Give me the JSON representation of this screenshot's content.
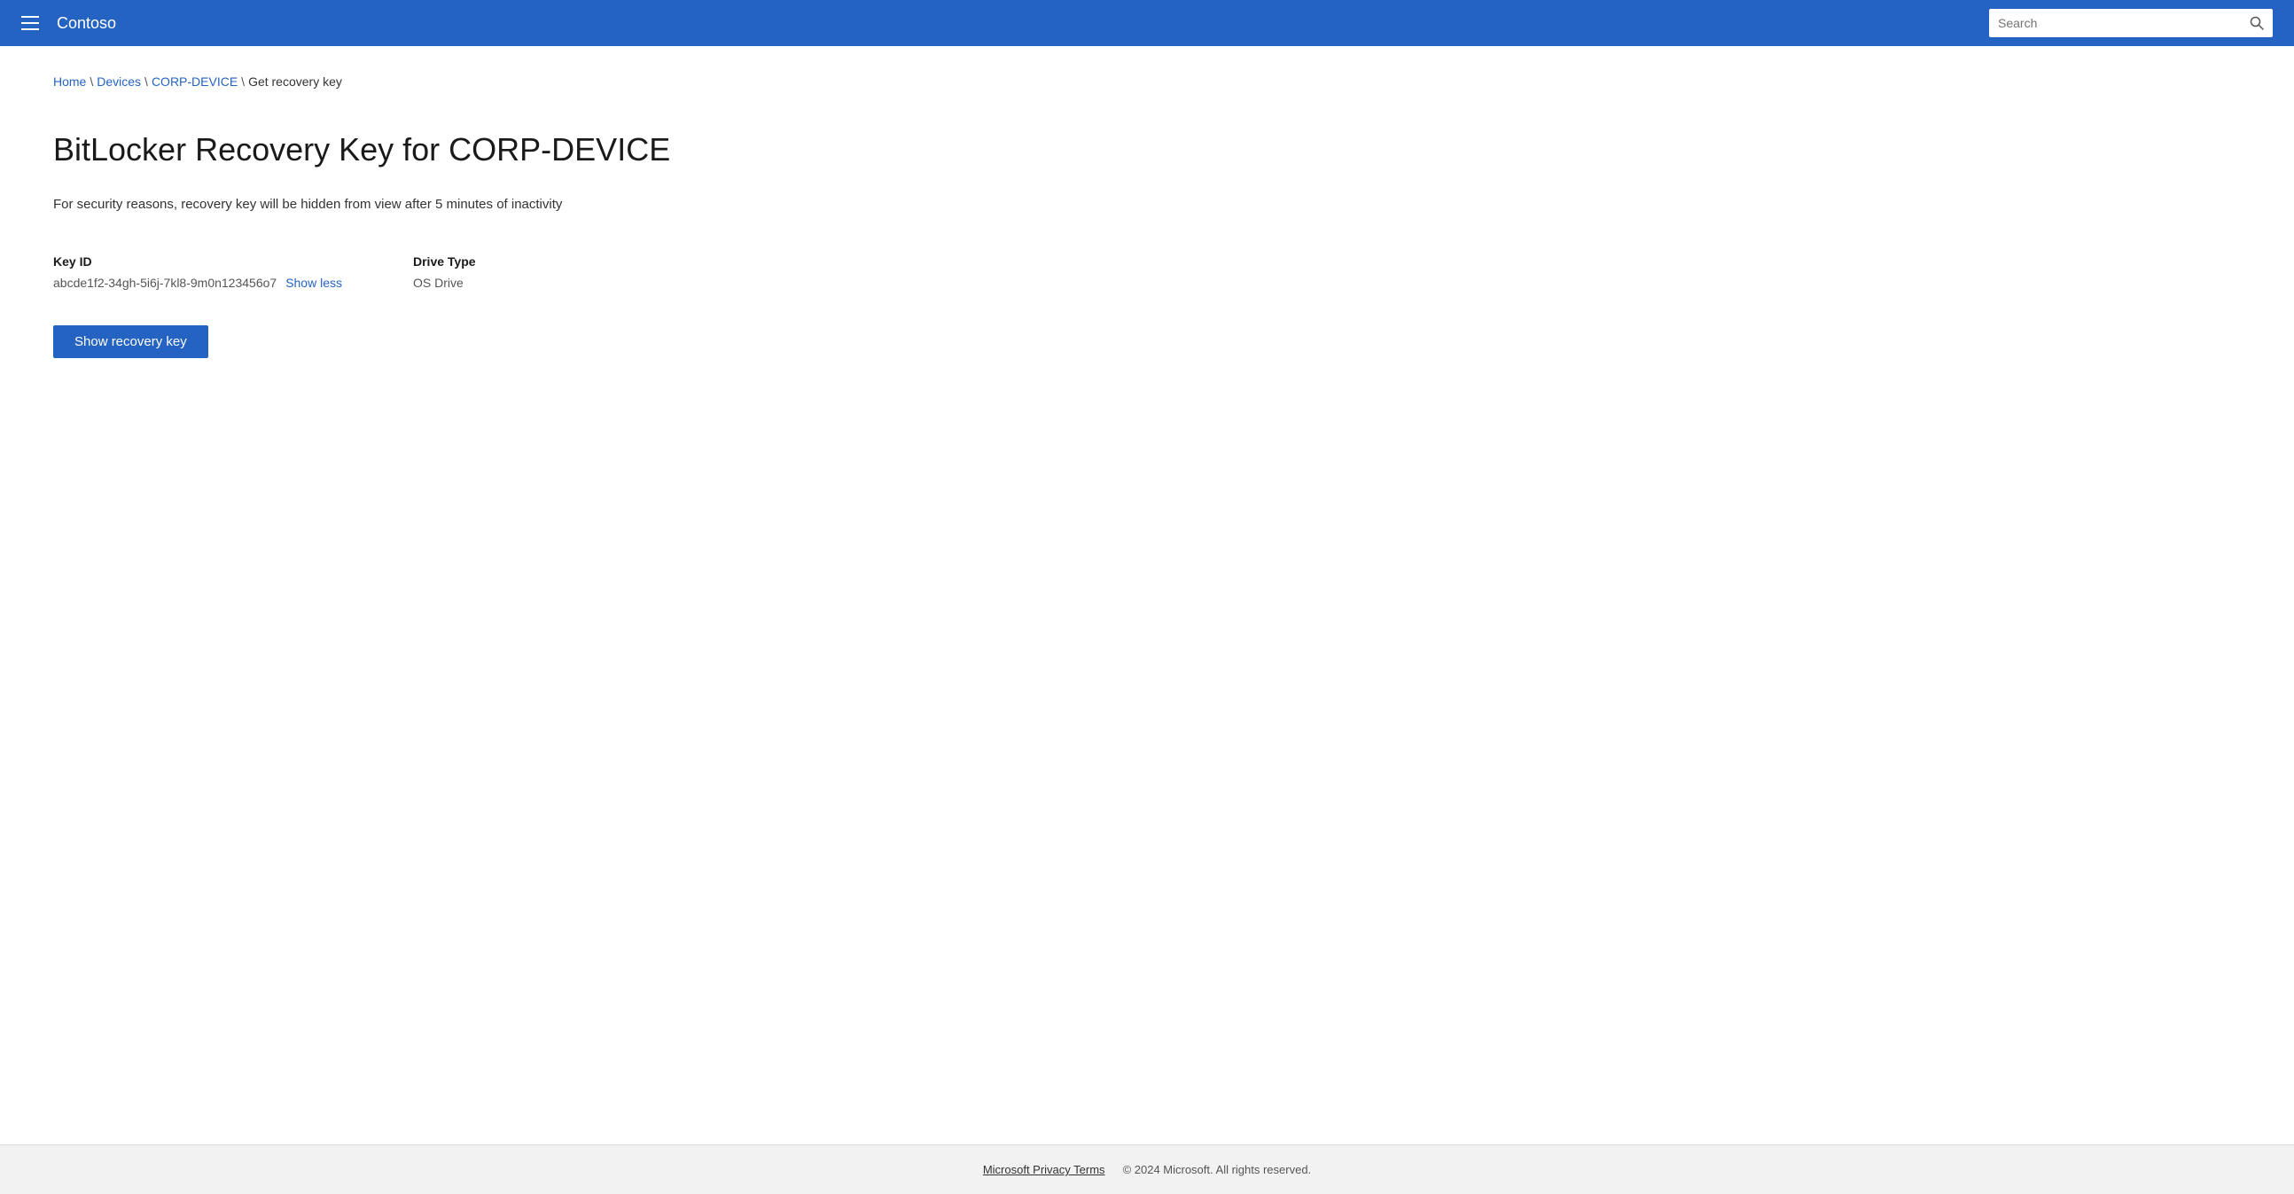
{
  "header": {
    "brand_name": "Contoso",
    "search_placeholder": "Search"
  },
  "breadcrumb": {
    "home_label": "Home",
    "devices_label": "Devices",
    "device_label": "CORP-DEVICE",
    "current_label": "Get recovery key"
  },
  "main": {
    "page_title": "BitLocker Recovery Key for CORP-DEVICE",
    "security_notice": "For security reasons, recovery key will be hidden from view after 5 minutes of inactivity",
    "key_id_label": "Key ID",
    "key_id_value": "abcde1f2-34gh-5i6j-7kl8-9m0n123456o7",
    "show_less_label": "Show less",
    "drive_type_label": "Drive Type",
    "drive_type_value": "OS Drive",
    "show_key_button": "Show recovery key"
  },
  "footer": {
    "privacy_terms_label": "Microsoft Privacy Terms",
    "copyright_text": "© 2024 Microsoft. All rights reserved."
  }
}
